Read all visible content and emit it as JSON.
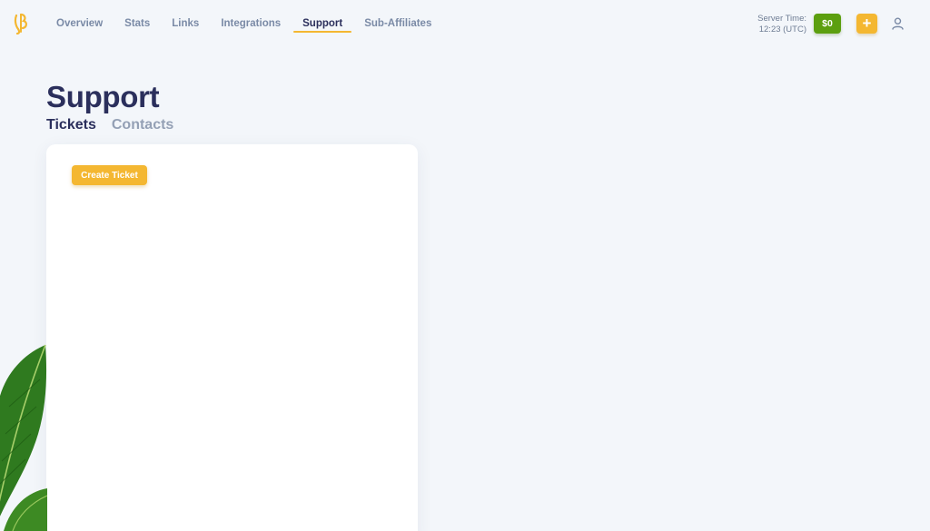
{
  "nav": {
    "items": [
      {
        "label": "Overview",
        "active": false
      },
      {
        "label": "Stats",
        "active": false
      },
      {
        "label": "Links",
        "active": false
      },
      {
        "label": "Integrations",
        "active": false
      },
      {
        "label": "Support",
        "active": true
      },
      {
        "label": "Sub-Affiliates",
        "active": false
      }
    ]
  },
  "header": {
    "server_time_label": "Server Time:",
    "server_time_value": "12:23 (UTC)",
    "balance": "$0",
    "add_button_symbol": "+"
  },
  "page": {
    "title": "Support",
    "tabs": [
      {
        "label": "Tickets",
        "active": true
      },
      {
        "label": "Contacts",
        "active": false
      }
    ]
  },
  "card": {
    "create_ticket_label": "Create Ticket"
  },
  "colors": {
    "accent": "#f4b731",
    "balance_green": "#5c9f0f",
    "title_navy": "#2b2f5c",
    "nav_muted": "#7a8aa6",
    "background": "#f3f6fa"
  },
  "icons": {
    "logo": "brand-logo-icon",
    "user": "user-icon",
    "decoration": "leaf-decoration"
  }
}
